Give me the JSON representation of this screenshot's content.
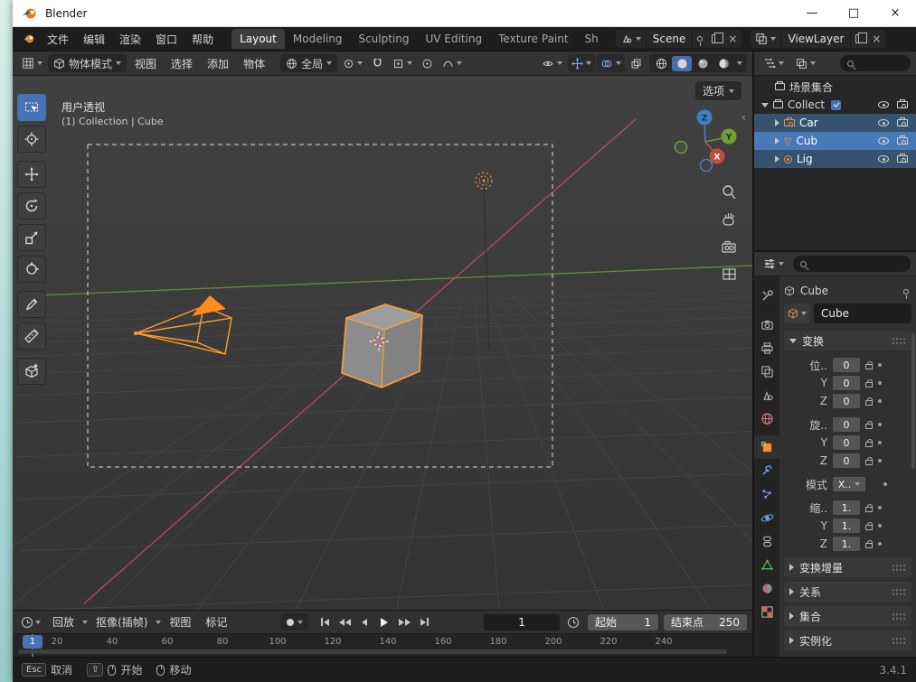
{
  "window": {
    "title": "Blender",
    "controls": {
      "minimize": "—",
      "maximize": "□",
      "close": "×"
    }
  },
  "topbar": {
    "menus": [
      "文件",
      "编辑",
      "渲染",
      "窗口",
      "帮助"
    ],
    "workspaces": [
      "Layout",
      "Modeling",
      "Sculpting",
      "UV Editing",
      "Texture Paint",
      "Sh"
    ],
    "active_workspace": "Layout",
    "scene_selector": {
      "value": "Scene"
    },
    "viewlayer_selector": {
      "value": "ViewLayer"
    }
  },
  "viewport_header": {
    "mode_selector": "物体模式",
    "menus": [
      "视图",
      "选择",
      "添加",
      "物体"
    ],
    "orientation_selector": "全局"
  },
  "viewport": {
    "view_label": "用户透视",
    "context_label": "(1) Collection | Cube",
    "options_button": "选项",
    "axis_gizmo": {
      "x": "X",
      "y": "Y",
      "z": "Z"
    }
  },
  "outliner": {
    "scene_collection": "场景集合",
    "rows": [
      {
        "name": "Collect",
        "type": "collection"
      },
      {
        "name": "Car",
        "type": "camera"
      },
      {
        "name": "Cub",
        "type": "mesh"
      },
      {
        "name": "Lig",
        "type": "light"
      }
    ]
  },
  "properties": {
    "breadcrumb": "Cube",
    "name_field": "Cube",
    "transform": {
      "title": "变换",
      "axis_y": "Y",
      "axis_z": "Z",
      "location": {
        "label": "位..",
        "x": "0",
        "y": "0",
        "z": "0"
      },
      "rotation": {
        "label": "旋..",
        "x": "0",
        "y": "0",
        "z": "0"
      },
      "mode": {
        "label": "模式",
        "value": "X.."
      },
      "scale": {
        "label": "缩..",
        "x": "1.",
        "y": "1.",
        "z": "1."
      }
    },
    "collapsed_panels": [
      "变换增量",
      "关系",
      "集合",
      "实例化"
    ]
  },
  "timeline": {
    "menus": [
      "回放",
      "抠像(插帧)",
      "视图",
      "标记"
    ],
    "current_frame": "1",
    "start": {
      "label": "起始",
      "value": "1"
    },
    "end": {
      "label": "结束点",
      "value": "250"
    },
    "playhead_label": "1",
    "ruler": [
      "20",
      "40",
      "60",
      "80",
      "100",
      "120",
      "140",
      "160",
      "180",
      "200",
      "220",
      "240"
    ]
  },
  "statusbar": {
    "hints": [
      {
        "key": "Esc",
        "label": "取消"
      },
      {
        "key": "⇧",
        "label": "开始"
      },
      {
        "label": "移动"
      }
    ],
    "version": "3.4.1"
  },
  "colors": {
    "selection_orange": "#ffa028",
    "active_blue": "#4772b3",
    "axis_x_red": "#b05060",
    "axis_y_green": "#6fa21c",
    "axis_z_blue": "#3f7fbf",
    "titlebar_bg": "#ffffff"
  }
}
